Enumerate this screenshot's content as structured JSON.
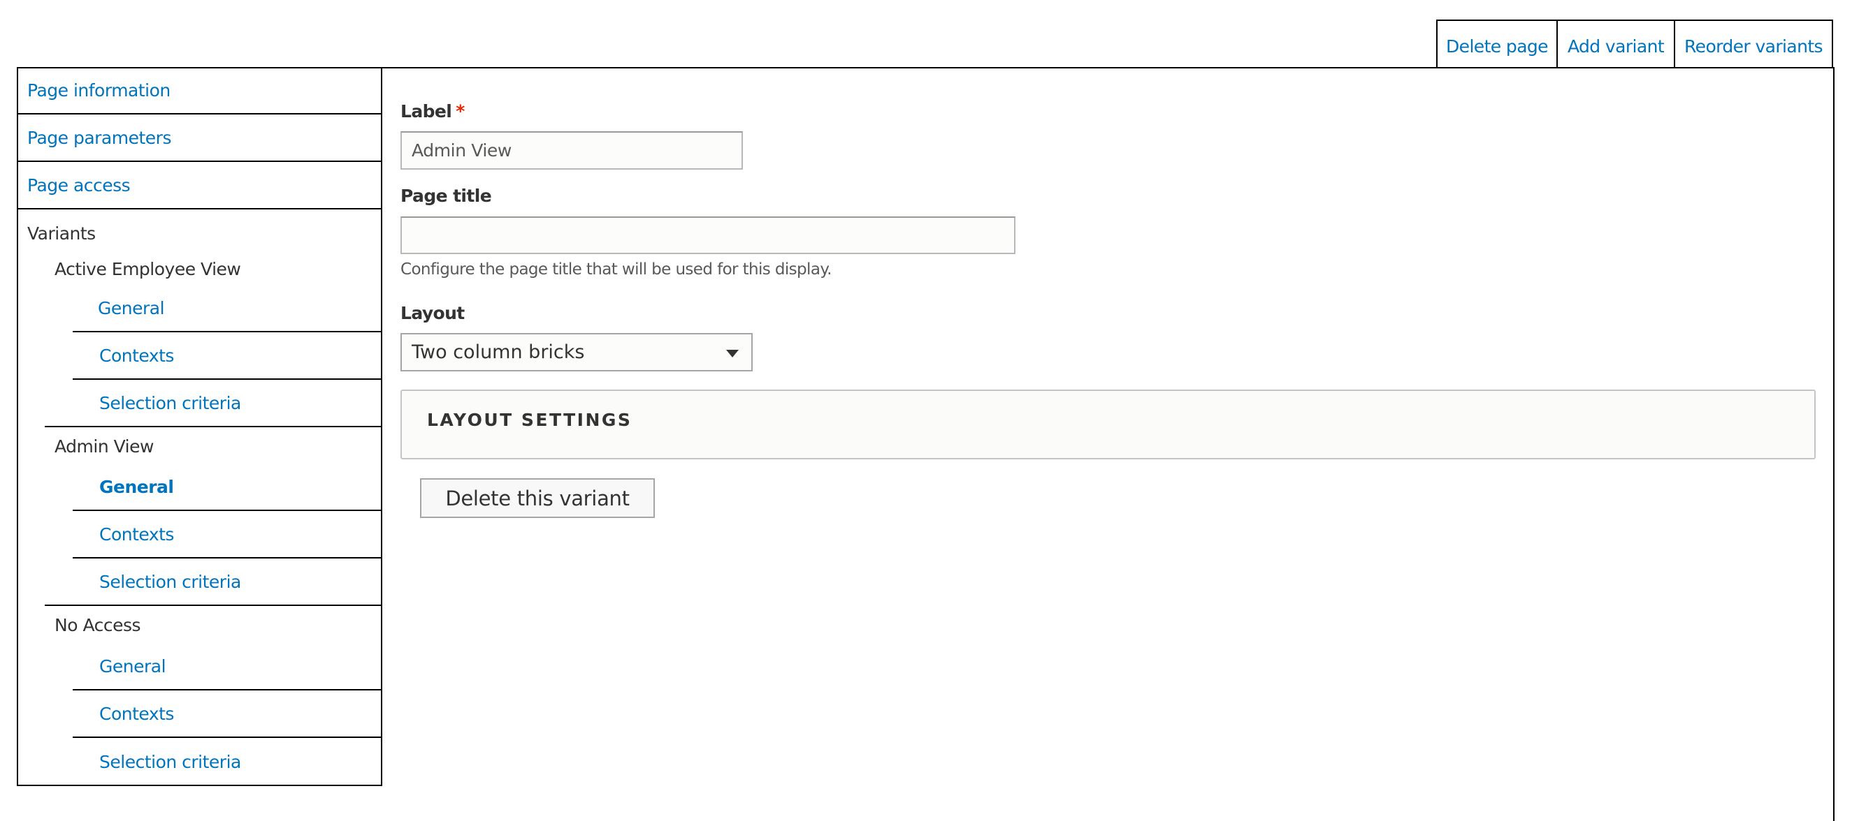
{
  "top_actions": {
    "delete_page": "Delete page",
    "add_variant": "Add variant",
    "reorder_variants": "Reorder variants"
  },
  "sidebar": {
    "page_information": "Page information",
    "page_parameters": "Page parameters",
    "page_access": "Page access",
    "variants_heading": "Variants",
    "variants": [
      {
        "name": "Active Employee View",
        "items": [
          "General",
          "Contexts",
          "Selection criteria"
        ]
      },
      {
        "name": "Admin View",
        "items": [
          "General",
          "Contexts",
          "Selection criteria"
        ],
        "active_item": "General"
      },
      {
        "name": "No Access",
        "items": [
          "General",
          "Contexts",
          "Selection criteria"
        ]
      }
    ]
  },
  "form": {
    "label_field": {
      "label": "Label",
      "required_marker": "*",
      "value": "Admin View"
    },
    "page_title_field": {
      "label": "Page title",
      "value": "",
      "description": "Configure the page title that will be used for this display."
    },
    "layout_field": {
      "label": "Layout",
      "selected": "Two column bricks"
    },
    "layout_settings": {
      "summary": "Layout settings"
    },
    "delete_variant_button": "Delete this variant"
  },
  "colors": {
    "link": "#0074bd",
    "required": "#e62600",
    "text": "#333333",
    "border": "#000000"
  }
}
